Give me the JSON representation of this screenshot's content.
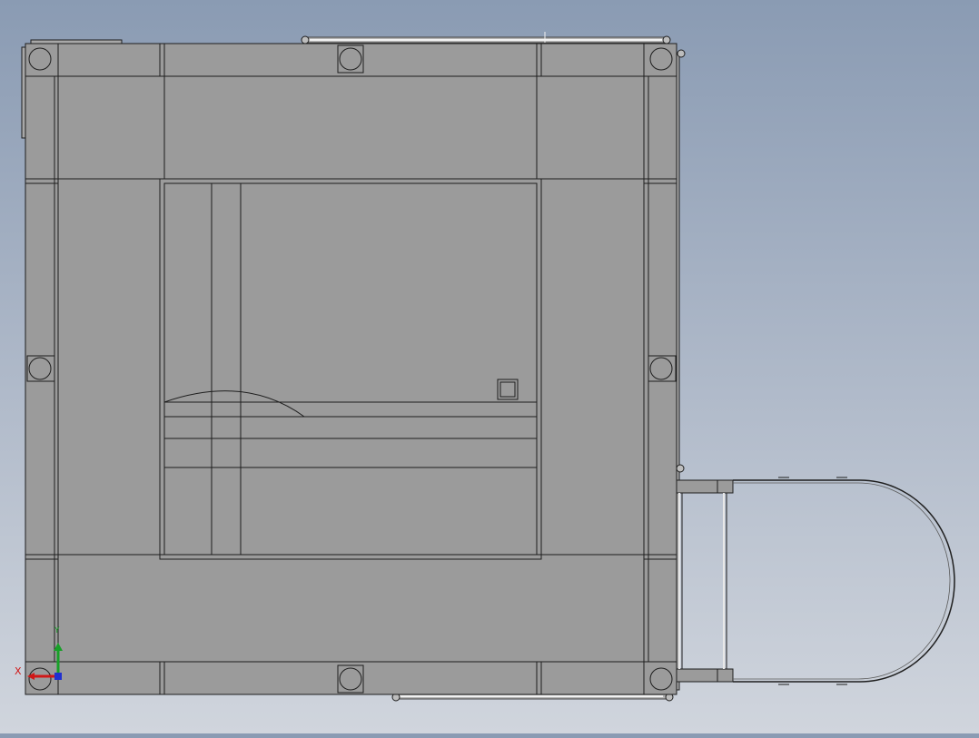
{
  "view": {
    "background_top": "#8a9bb3",
    "background_bottom": "#d0d5dd",
    "part_fill": "#9b9b9b",
    "edge_color": "#1e1e1e"
  },
  "triad": {
    "x_label": "X",
    "y_label": "Y",
    "x_color": "#d01818",
    "y_color": "#18a028",
    "z_color": "#2030d0"
  }
}
